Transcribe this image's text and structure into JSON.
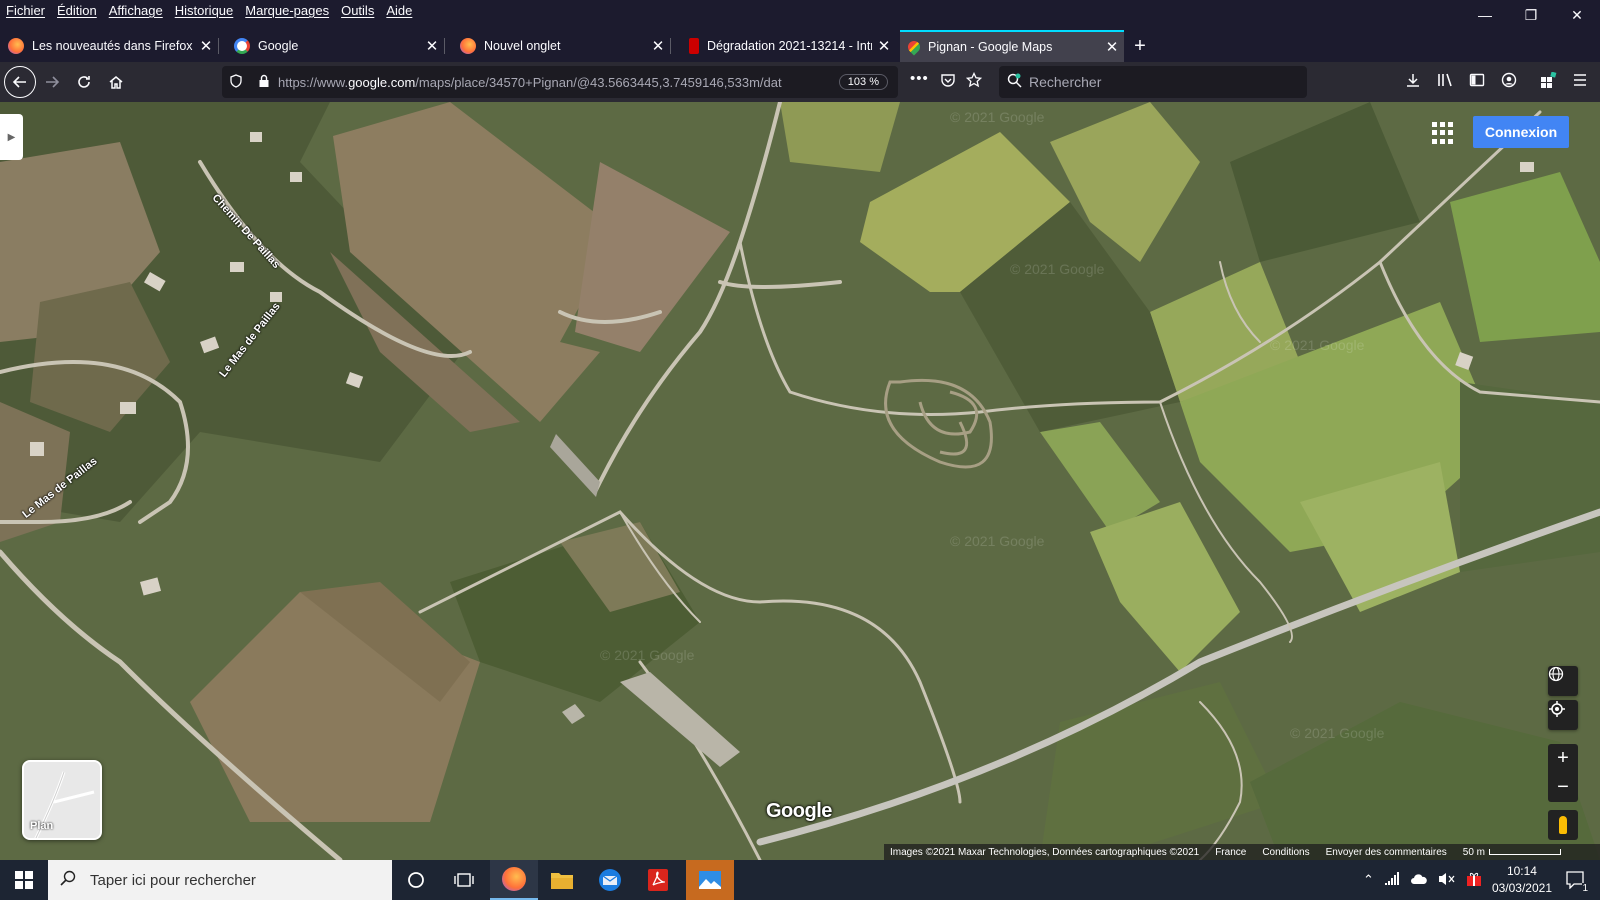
{
  "menubar": {
    "items": [
      "Fichier",
      "Édition",
      "Affichage",
      "Historique",
      "Marque-pages",
      "Outils",
      "Aide"
    ],
    "window_controls": {
      "minimize": "—",
      "restore": "❐",
      "close": "✕"
    }
  },
  "tabs": [
    {
      "label": "Les nouveautés dans Firefox",
      "icon": "firefox-icon",
      "close": "✕"
    },
    {
      "label": "Google",
      "icon": "google-icon",
      "close": "✕"
    },
    {
      "label": "Nouvel onglet",
      "icon": "firefox-icon",
      "close": "✕"
    },
    {
      "label": "Dégradation 2021-13214 - Intra",
      "icon": "intranet-icon",
      "close": "✕"
    },
    {
      "label": "Pignan - Google Maps",
      "icon": "maps-pin-icon",
      "close": "✕",
      "active": true
    }
  ],
  "newtab": "+",
  "nav": {
    "url_prefix": "https://www.",
    "url_domain": "google.com",
    "url_rest": "/maps/place/34570+Pignan/@43.5663445,3.7459146,533m/dat",
    "zoom": "103 %",
    "more": "•••",
    "search_placeholder": "Rechercher"
  },
  "map": {
    "road_labels": [
      "Chemin De Paillas",
      "Le Mas de Paillas",
      "Le Mas de Paillas"
    ],
    "watermarks": [
      "© 2021 Google",
      "© 2021 Google",
      "© 2021 Google",
      "© 2021 Google",
      "© 2021 Google",
      "© 2021 Google"
    ],
    "signin_label": "Connexion",
    "plan_label": "Plan",
    "logo": "Google",
    "footer": {
      "images": "Images ©2021 Maxar Technologies, Données cartographiques ©2021",
      "country": "France",
      "terms": "Conditions",
      "feedback": "Envoyer des commentaires",
      "scale": "50 m"
    },
    "controls": {
      "zoom_in": "+",
      "zoom_out": "−"
    }
  },
  "taskbar": {
    "search_placeholder": "Taper ici pour rechercher",
    "time": "10:14",
    "date": "03/03/2021",
    "notification_count": "1"
  },
  "colors": {
    "accent": "#0df",
    "maps_blue": "#4285f4",
    "field_dark": "#55633f",
    "field_light": "#9aa85a"
  }
}
